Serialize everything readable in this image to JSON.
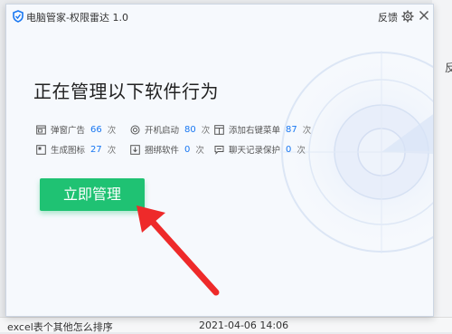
{
  "window": {
    "title": "电脑管家-权限雷达 1.0",
    "feedback_label": "反馈"
  },
  "main": {
    "headline": "正在管理以下软件行为",
    "unit_label": "次",
    "stats": [
      {
        "label": "弹窗广告",
        "value": "66",
        "icon": "popup-ad-icon"
      },
      {
        "label": "开机启动",
        "value": "80",
        "icon": "power-icon"
      },
      {
        "label": "添加右键菜单",
        "value": "87",
        "icon": "context-menu-icon"
      },
      {
        "label": "生成图标",
        "value": "27",
        "icon": "desktop-shortcut-icon"
      },
      {
        "label": "捆绑软件",
        "value": "0",
        "icon": "bundle-install-icon"
      },
      {
        "label": "聊天记录保护",
        "value": "0",
        "icon": "chat-protection-icon"
      }
    ],
    "manage_button_label": "立即管理"
  },
  "background": {
    "right_edge_char": "反",
    "bottom_left_text": "excel表个其他怎么排序",
    "bottom_date": "2021-04-06 14:06"
  },
  "colors": {
    "accent_blue": "#1877f2",
    "button_green": "#1fc273",
    "arrow_red": "#ee2a2a"
  }
}
